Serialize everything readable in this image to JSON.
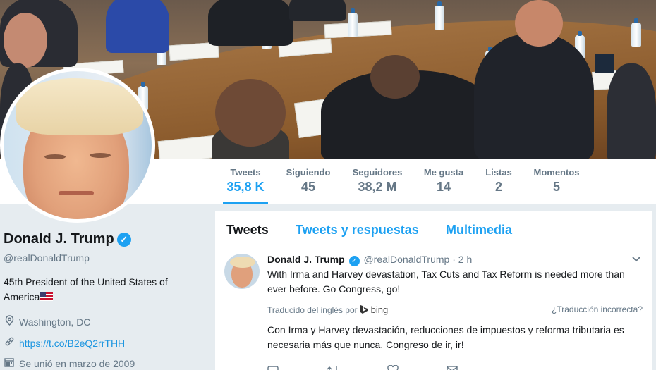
{
  "nav": {
    "stats": [
      {
        "label": "Tweets",
        "value": "35,8 K",
        "active": true
      },
      {
        "label": "Siguiendo",
        "value": "45"
      },
      {
        "label": "Seguidores",
        "value": "38,2 M"
      },
      {
        "label": "Me gusta",
        "value": "14"
      },
      {
        "label": "Listas",
        "value": "2"
      },
      {
        "label": "Momentos",
        "value": "5"
      }
    ]
  },
  "profile": {
    "name": "Donald J. Trump",
    "verified_glyph": "✓",
    "handle": "@realDonaldTrump",
    "bio": "45th President of the United States of America",
    "location": "Washington, DC",
    "url": "https://t.co/B2eQ2rrTHH",
    "joined": "Se unió en marzo de 2009",
    "icons": [
      "location-pin-icon",
      "link-icon",
      "calendar-icon"
    ]
  },
  "timeline": {
    "tabs": [
      "Tweets",
      "Tweets y respuestas",
      "Multimedia"
    ],
    "tweet": {
      "name": "Donald J. Trump",
      "handle": "@realDonaldTrump",
      "time": "· 2 h",
      "text": "With Irma and Harvey devastation, Tax Cuts and Tax Reform is needed more than ever before. Go Congress, go!",
      "translated_from": "Traducido del inglés por",
      "bing": "bing",
      "wrong_translation": "¿Traducción incorrecta?",
      "translation": "Con Irma y Harvey devastación, reducciones de impuestos y reforma tributaria es necesaria más que nunca. Congreso de ir, ir!"
    }
  },
  "colors": {
    "accent": "#1da1f2",
    "background": "#e6ecf0",
    "text": "#14171a",
    "muted": "#657786"
  }
}
